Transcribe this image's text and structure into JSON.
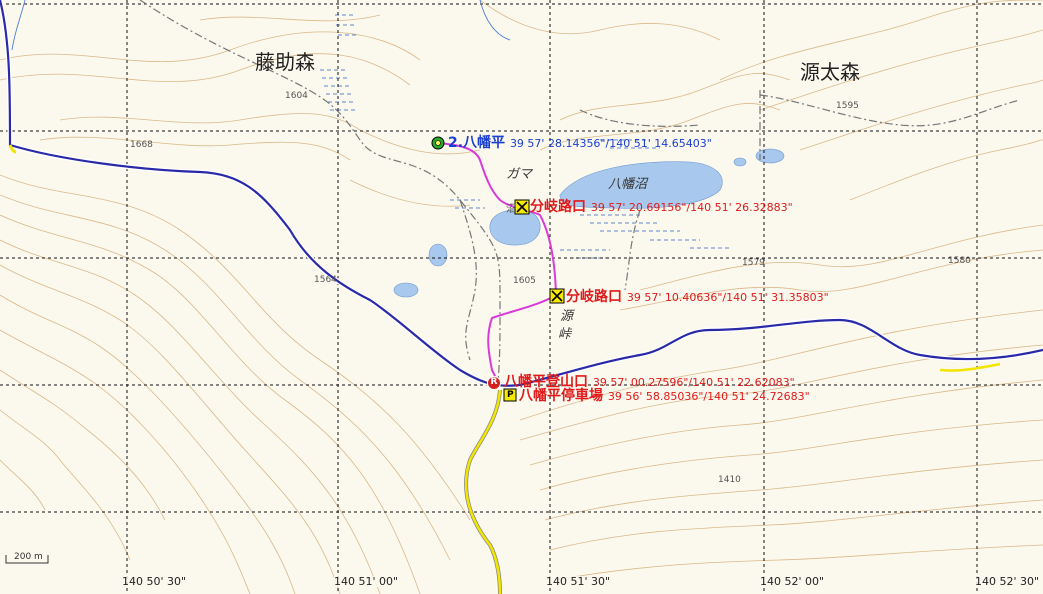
{
  "place_names": {
    "fujisuke_mori": "藤助森",
    "genta_mori": "源太森",
    "hachiman_numa": "八幡沼",
    "gama": "ガマ",
    "numa_small": "沼",
    "toge_1": "源",
    "toge_2": "峠"
  },
  "elevations": {
    "e1604": "1604",
    "e1668": "1668",
    "e1595": "1595",
    "e1564": "1564",
    "e1605": "1605",
    "e1579": "1579",
    "e1580": "1580",
    "e1410": "1410"
  },
  "waypoints": [
    {
      "id": "hachimantai",
      "label": "2.八幡平",
      "coord": "39 57' 28.14356\"/140 51' 14.65403\"",
      "color": "#1a3fd0",
      "icon": "green-circle-icon"
    },
    {
      "id": "bunki1",
      "label": "分岐路口",
      "coord": "39 57' 20.69156\"/140 51' 26.32883\"",
      "color": "#e01a1a",
      "icon": "junction-x-icon"
    },
    {
      "id": "bunki2",
      "label": "分岐路口",
      "coord": "39 57' 10.40636\"/140 51' 31.35803\"",
      "color": "#e01a1a",
      "icon": "junction-x-icon"
    },
    {
      "id": "tozanguchi",
      "label": "八幡平登山口",
      "coord": "39 57' 00.27596\"/140 51' 22.62083\"",
      "color": "#e01a1a",
      "icon": "trailhead-r-icon",
      "badge": "R"
    },
    {
      "id": "parking",
      "label": "八幡平停車場",
      "coord": "39 56' 58.85036\"/140 51' 24.72683\"",
      "color": "#e01a1a",
      "icon": "parking-p-icon",
      "badge": "P"
    }
  ],
  "grid_labels": [
    "140 50' 30\"",
    "140 51' 00\"",
    "140 51' 30\"",
    "140 52' 00\"",
    "140 52' 30\""
  ],
  "scale": {
    "label": "200 m"
  },
  "colors": {
    "background": "#fbf8ee",
    "contour": "#d9b98a",
    "road_blue": "#2a2aa8",
    "road_yellow": "#f2e600",
    "track": "#d83cd8",
    "water": "#a8c8ee"
  }
}
